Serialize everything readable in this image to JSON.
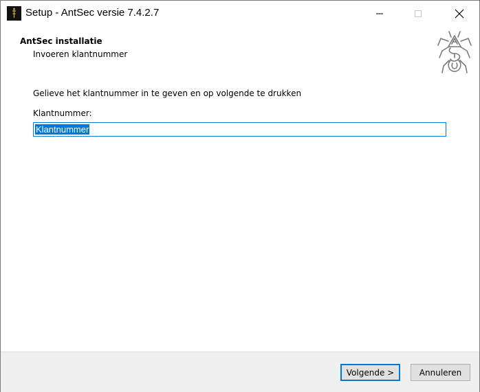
{
  "window": {
    "title": "Setup - AntSec versie 7.4.2.7",
    "icon": "antsec-app-icon"
  },
  "header": {
    "title": "AntSec installatie",
    "subtitle": "Invoeren klantnummer",
    "logo": "antsec-logo-icon"
  },
  "main": {
    "instruction": "Gelieve het klantnummer in te geven en op volgende te drukken",
    "field_label": "Klantnummer:",
    "field_value": "Klantnummer"
  },
  "footer": {
    "next_label": "Volgende >",
    "cancel_label": "Annuleren"
  },
  "colors": {
    "accent": "#0078d7",
    "footer_bg": "#f0f0f0"
  }
}
